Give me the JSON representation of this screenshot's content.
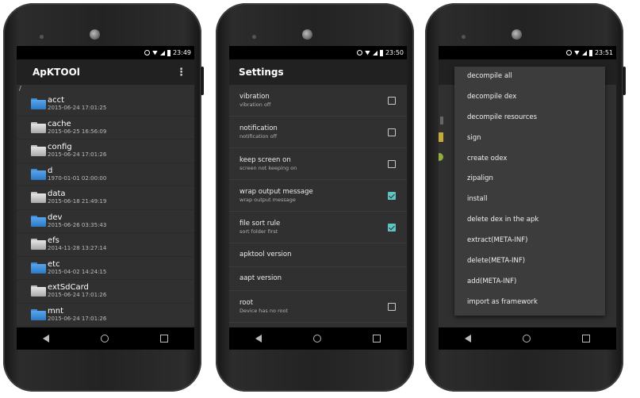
{
  "status": {
    "time_1": "23:49",
    "time_2": "23:50",
    "time_3": "23:51"
  },
  "colors": {
    "accent_check": "#5fc3c3",
    "folder_blue": "#3a8ad6",
    "appbar": "#212121",
    "background": "#303030"
  },
  "phone1": {
    "title": "ApKTOOl",
    "menu_icon": "⋮",
    "path": "/",
    "files": [
      {
        "name": "acct",
        "date": "2015-06-24 17:01:25",
        "color": "blue"
      },
      {
        "name": "cache",
        "date": "2015-06-25 16:56:09",
        "color": "grey"
      },
      {
        "name": "config",
        "date": "2015-06-24 17:01:26",
        "color": "grey"
      },
      {
        "name": "d",
        "date": "1970-01-01 02:00:00",
        "color": "blue"
      },
      {
        "name": "data",
        "date": "2015-06-18 21:49:19",
        "color": "grey"
      },
      {
        "name": "dev",
        "date": "2015-06-26 03:35:43",
        "color": "blue"
      },
      {
        "name": "efs",
        "date": "2014-11-28 13:27:14",
        "color": "grey"
      },
      {
        "name": "etc",
        "date": "2015-04-02 14:24:15",
        "color": "blue"
      },
      {
        "name": "extSdCard",
        "date": "2015-06-24 17:01:26",
        "color": "grey"
      },
      {
        "name": "mnt",
        "date": "2015-06-24 17:01:26",
        "color": "blue"
      }
    ]
  },
  "phone2": {
    "title": "Settings",
    "settings": [
      {
        "title": "vibration",
        "subtitle": "vibration off",
        "checked": false
      },
      {
        "title": "notification",
        "subtitle": "notification off",
        "checked": false
      },
      {
        "title": "keep screen on",
        "subtitle": "screen not keeping on",
        "checked": false
      },
      {
        "title": "wrap output message",
        "subtitle": "wrap output message",
        "checked": true
      },
      {
        "title": "file sort rule",
        "subtitle": "sort folder first",
        "checked": true
      },
      {
        "title": "apktool version",
        "subtitle": "",
        "checked": null
      },
      {
        "title": "aapt version",
        "subtitle": "",
        "checked": null
      },
      {
        "title": "root",
        "subtitle": "Device has no root",
        "checked": false
      }
    ]
  },
  "phone3": {
    "menu_items": [
      "decompile all",
      "decompile dex",
      "decompile resources",
      "sign",
      "create odex",
      "zipalign",
      "install",
      "delete dex in the apk",
      "extract(META-INF)",
      "delete(META-INF)",
      "add(META-INF)",
      "import as framework"
    ]
  }
}
